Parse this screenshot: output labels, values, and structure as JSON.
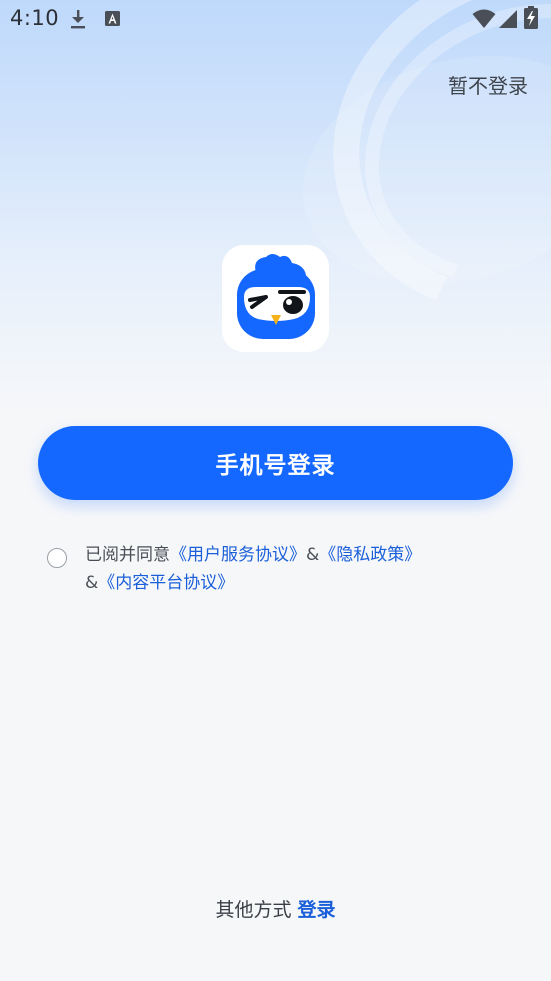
{
  "status_bar": {
    "time": "4:10",
    "icons": [
      "download-icon",
      "a-notification-icon",
      "wifi-icon",
      "signal-icon",
      "battery-icon"
    ]
  },
  "header": {
    "skip_login": "暂不登录"
  },
  "logo": {
    "icon": "owl-mascot-icon",
    "brand_color": "#1467ff"
  },
  "login": {
    "phone_login_label": "手机号登录"
  },
  "agreement": {
    "checked": false,
    "prefix": "已阅并同意",
    "user_agreement": "《用户服务协议》",
    "amp1": "&",
    "privacy_policy": "《隐私政策》",
    "amp2": "&",
    "content_agreement": "《内容平台协议》"
  },
  "footer": {
    "other_methods": "其他方式",
    "other_login": "登录"
  },
  "colors": {
    "accent": "#1467ff",
    "link": "#1a5fd9",
    "text": "#3a3f47"
  }
}
